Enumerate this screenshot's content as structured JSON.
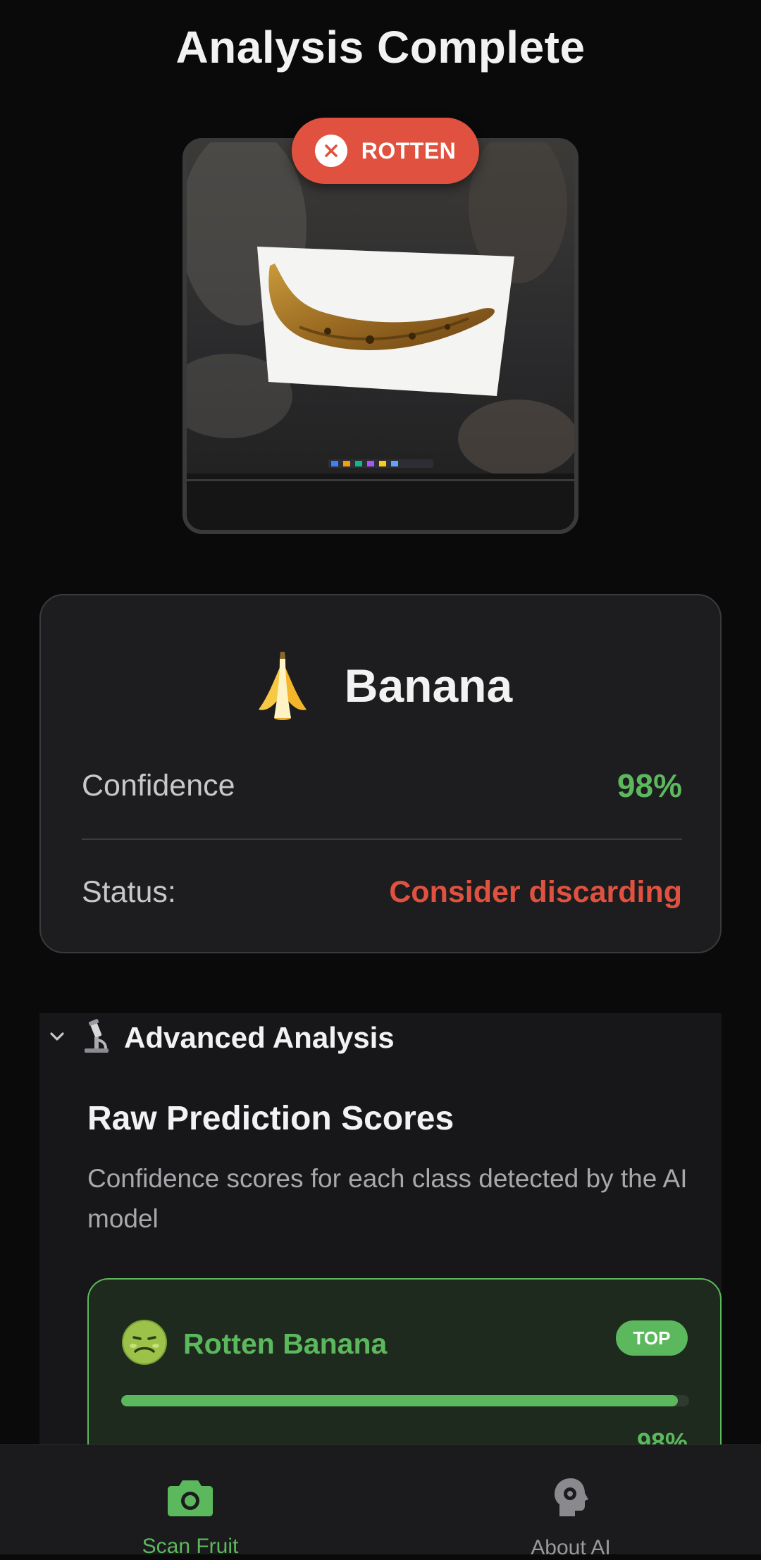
{
  "header": {
    "title": "Analysis Complete"
  },
  "photo": {
    "alt": "Laptop screen showing a photo of a rotten banana",
    "status_badge": {
      "label": "ROTTEN",
      "icon": "close-icon",
      "color": "#e0523f"
    }
  },
  "result": {
    "fruit_icon": "banana-emoji",
    "fruit_name": "Banana",
    "confidence_label": "Confidence",
    "confidence_value": "98%",
    "status_label": "Status:",
    "status_value": "Consider discarding",
    "colors": {
      "confidence": "#5cb85c",
      "status": "#e0523f"
    }
  },
  "advanced": {
    "toggle_icon": "chevron-down-icon",
    "icon": "microscope-icon",
    "title": "Advanced Analysis",
    "section_title": "Raw Prediction Scores",
    "section_desc": "Confidence scores for each class detected by the AI model",
    "scores": [
      {
        "icon": "nauseated-face-icon",
        "label": "Rotten Banana",
        "badge": "TOP",
        "value": "98%",
        "fraction": 0.98
      }
    ]
  },
  "nav": {
    "items": [
      {
        "label": "Scan Fruit",
        "icon": "camera-icon",
        "active": true
      },
      {
        "label": "About AI",
        "icon": "ai-head-icon",
        "active": false
      }
    ],
    "colors": {
      "active": "#5cb85c",
      "inactive": "#9a9a9e"
    }
  }
}
